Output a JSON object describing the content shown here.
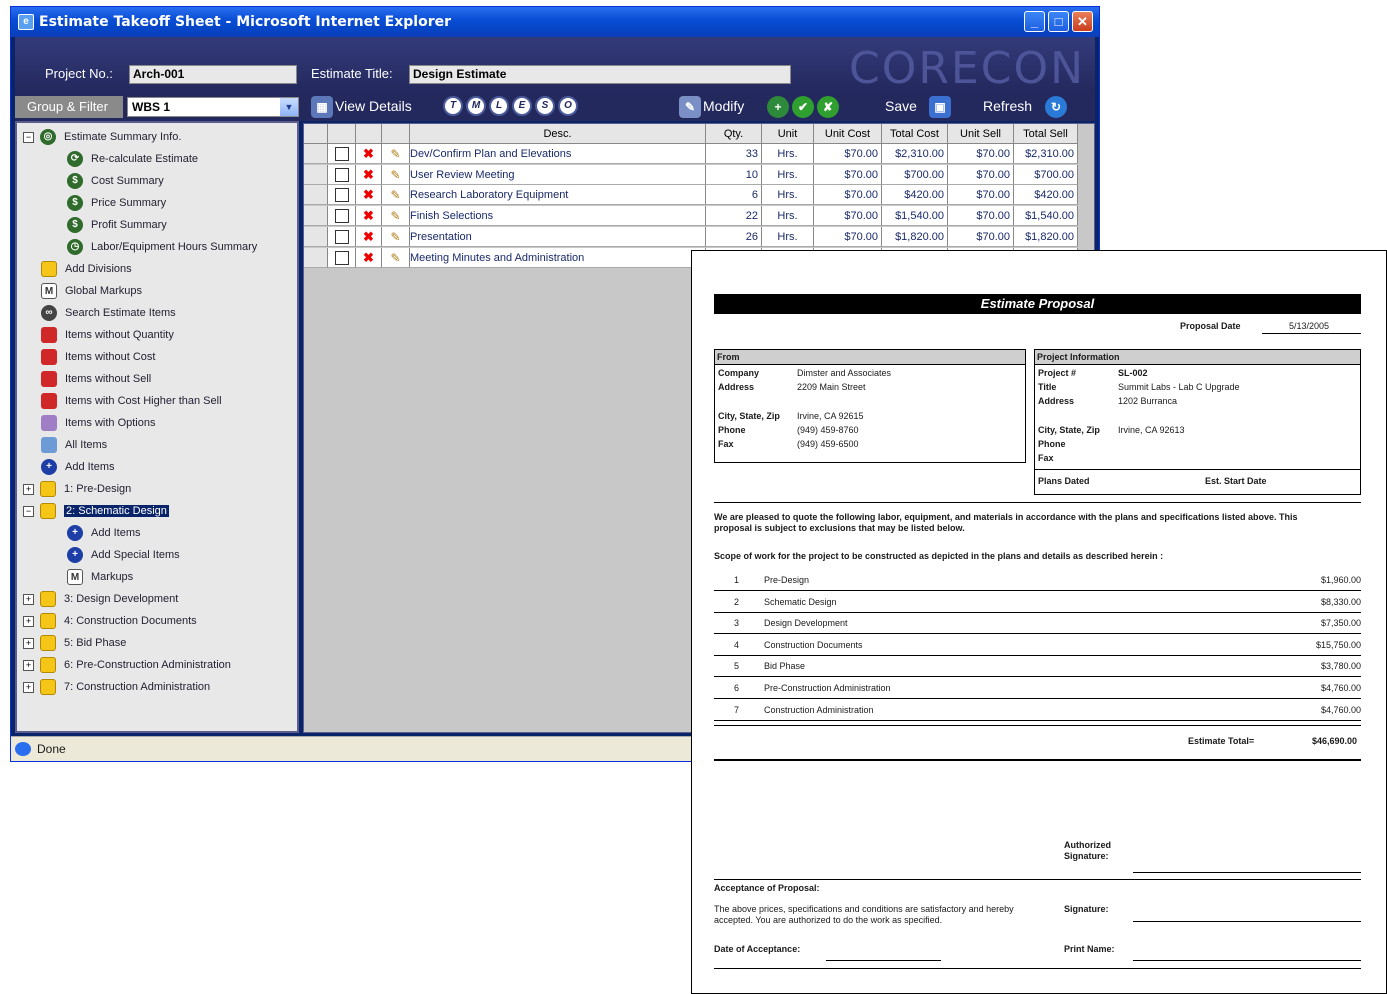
{
  "window": {
    "title": "Estimate Takeoff Sheet - Microsoft Internet Explorer",
    "status": "Done"
  },
  "header": {
    "project_no_label": "Project No.:",
    "project_no_value": "Arch-001",
    "estimate_title_label": "Estimate Title:",
    "estimate_title_value": "Design Estimate",
    "logo": "CORECON"
  },
  "toolbar": {
    "group_filter_label": "Group & Filter",
    "wbs_value": "WBS 1",
    "view_details_label": "View Details",
    "filter_buttons": [
      "T",
      "M",
      "L",
      "E",
      "S",
      "O"
    ],
    "modify_label": "Modify",
    "save_label": "Save",
    "refresh_label": "Refresh"
  },
  "tree": {
    "items": [
      {
        "label": "Estimate Summary Info.",
        "icon": "target-icon"
      },
      {
        "label": "Re-calculate Estimate",
        "icon": "recalc-icon"
      },
      {
        "label": "Cost Summary",
        "icon": "dollar-icon"
      },
      {
        "label": "Price Summary",
        "icon": "dollar-icon"
      },
      {
        "label": "Profit Summary",
        "icon": "dollar-icon"
      },
      {
        "label": "Labor/Equipment Hours Summary",
        "icon": "clock-icon"
      },
      {
        "label": "Add Divisions",
        "icon": "folder-add-icon"
      },
      {
        "label": "Global Markups",
        "icon": "markup-icon"
      },
      {
        "label": "Search Estimate Items",
        "icon": "binoculars-icon"
      },
      {
        "label": "Items without Quantity",
        "icon": "red-folder-icon"
      },
      {
        "label": "Items without Cost",
        "icon": "red-folder-icon"
      },
      {
        "label": "Items without Sell",
        "icon": "red-folder-icon"
      },
      {
        "label": "Items with Cost Higher than Sell",
        "icon": "red-folder-icon"
      },
      {
        "label": "Items with Options",
        "icon": "purple-folder-icon"
      },
      {
        "label": "All Items",
        "icon": "blue-folder-icon"
      },
      {
        "label": "Add Items",
        "icon": "plus-icon"
      },
      {
        "label": "1: Pre-Design",
        "icon": "folder-icon"
      },
      {
        "label": "2: Schematic Design",
        "icon": "folder-open-icon"
      },
      {
        "label": "Add Items",
        "icon": "plus-icon"
      },
      {
        "label": "Add Special Items",
        "icon": "plus-icon"
      },
      {
        "label": "Markups",
        "icon": "markup-icon"
      },
      {
        "label": "3: Design Development",
        "icon": "folder-icon"
      },
      {
        "label": "4: Construction Documents",
        "icon": "folder-icon"
      },
      {
        "label": "5: Bid Phase",
        "icon": "folder-icon"
      },
      {
        "label": "6: Pre-Construction Administration",
        "icon": "folder-icon"
      },
      {
        "label": "7: Construction Administration",
        "icon": "folder-icon"
      }
    ]
  },
  "grid": {
    "columns": [
      "Desc.",
      "Qty.",
      "Unit",
      "Unit Cost",
      "Total Cost",
      "Unit Sell",
      "Total Sell"
    ],
    "rows": [
      {
        "desc": "Dev/Confirm Plan and Elevations",
        "qty": "33",
        "unit": "Hrs.",
        "unit_cost": "$70.00",
        "total_cost": "$2,310.00",
        "unit_sell": "$70.00",
        "total_sell": "$2,310.00"
      },
      {
        "desc": "User Review Meeting",
        "qty": "10",
        "unit": "Hrs.",
        "unit_cost": "$70.00",
        "total_cost": "$700.00",
        "unit_sell": "$70.00",
        "total_sell": "$700.00"
      },
      {
        "desc": "Research Laboratory Equipment",
        "qty": "6",
        "unit": "Hrs.",
        "unit_cost": "$70.00",
        "total_cost": "$420.00",
        "unit_sell": "$70.00",
        "total_sell": "$420.00"
      },
      {
        "desc": "Finish Selections",
        "qty": "22",
        "unit": "Hrs.",
        "unit_cost": "$70.00",
        "total_cost": "$1,540.00",
        "unit_sell": "$70.00",
        "total_sell": "$1,540.00"
      },
      {
        "desc": "Presentation",
        "qty": "26",
        "unit": "Hrs.",
        "unit_cost": "$70.00",
        "total_cost": "$1,820.00",
        "unit_sell": "$70.00",
        "total_sell": "$1,820.00"
      },
      {
        "desc": "Meeting Minutes and Administration",
        "qty": "",
        "unit": "",
        "unit_cost": "",
        "total_cost": "",
        "unit_sell": "",
        "total_sell": ""
      }
    ]
  },
  "proposal": {
    "title": "Estimate Proposal",
    "proposal_date_label": "Proposal Date",
    "proposal_date": "5/13/2005",
    "from": {
      "heading": "From",
      "company_label": "Company",
      "company": "Dimster and Associates",
      "address_label": "Address",
      "address": "2209 Main Street",
      "city_label": "City, State, Zip",
      "city": "Irvine, CA 92615",
      "phone_label": "Phone",
      "phone": "(949) 459-8760",
      "fax_label": "Fax",
      "fax": "(949) 459-6500"
    },
    "project": {
      "heading": "Project Information",
      "project_label": "Project #",
      "project": "SL-002",
      "title_label": "Title",
      "title": "Summit Labs - Lab C Upgrade",
      "address_label": "Address",
      "address": "1202 Burranca",
      "city_label": "City, State, Zip",
      "city": "Irvine, CA 92613",
      "phone_label": "Phone",
      "fax_label": "Fax",
      "plans_dated_label": "Plans Dated",
      "start_date_label": "Est. Start Date"
    },
    "intro_line1": "We are pleased to quote the following labor, equipment, and materials in accordance with the plans and specifications listed above. This",
    "intro_line2": "proposal is subject to exclusions that may be listed below.",
    "scope_heading": "Scope of work for the project to be constructed as depicted in the plans and details as described herein :",
    "scope": [
      {
        "num": "1",
        "name": "Pre-Design",
        "amount": "$1,960.00"
      },
      {
        "num": "2",
        "name": "Schematic Design",
        "amount": "$8,330.00"
      },
      {
        "num": "3",
        "name": "Design Development",
        "amount": "$7,350.00"
      },
      {
        "num": "4",
        "name": "Construction Documents",
        "amount": "$15,750.00"
      },
      {
        "num": "5",
        "name": "Bid Phase",
        "amount": "$3,780.00"
      },
      {
        "num": "6",
        "name": "Pre-Construction Administration",
        "amount": "$4,760.00"
      },
      {
        "num": "7",
        "name": "Construction Administration",
        "amount": "$4,760.00"
      }
    ],
    "total_label": "Estimate Total=",
    "total": "$46,690.00",
    "authorized_label_1": "Authorized",
    "authorized_label_2": "Signature:",
    "acceptance_heading": "Acceptance of Proposal:",
    "acceptance_text_1": "The above prices, specifications and conditions are satisfactory and hereby",
    "acceptance_text_2": "accepted. You are authorized to do the work as specified.",
    "signature_label": "Signature:",
    "date_acceptance_label": "Date of Acceptance:",
    "print_name_label": "Print Name:"
  }
}
